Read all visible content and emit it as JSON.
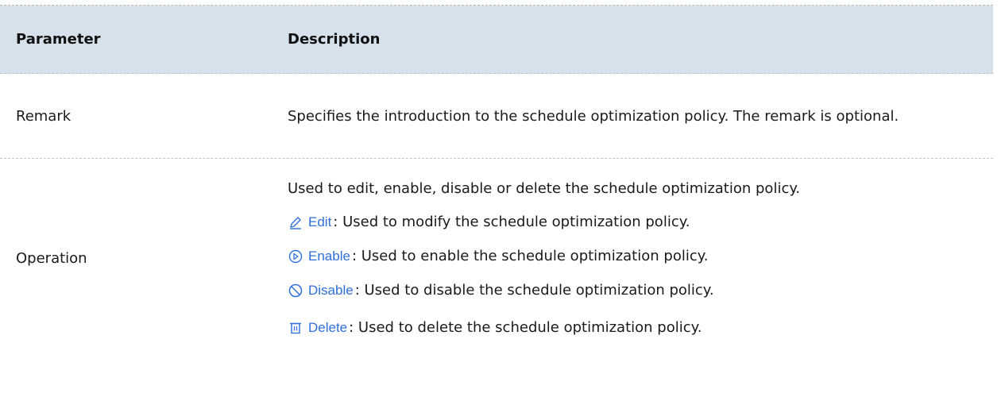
{
  "table": {
    "headers": {
      "parameter": "Parameter",
      "description": "Description"
    },
    "rows": [
      {
        "parameter": "Remark",
        "description": "Specifies the introduction to the schedule optimization policy. The remark is optional."
      },
      {
        "parameter": "Operation",
        "description_intro": "Used to edit, enable, disable or delete the schedule optimization policy.",
        "operations": [
          {
            "icon": "pencil-icon",
            "label": "Edit",
            "text": ": Used to modify the schedule optimization policy."
          },
          {
            "icon": "play-circle-icon",
            "label": "Enable",
            "text": ": Used to enable the schedule optimization policy."
          },
          {
            "icon": "prohibit-icon",
            "label": "Disable",
            "text": ": Used to disable the schedule optimization policy."
          },
          {
            "icon": "trash-icon",
            "label": "Delete",
            "text": ": Used to delete the schedule optimization policy."
          }
        ]
      }
    ]
  },
  "colors": {
    "header_bg": "#d7e1ec",
    "link_blue": "#2f6fdc",
    "border": "#c3c3c3"
  }
}
